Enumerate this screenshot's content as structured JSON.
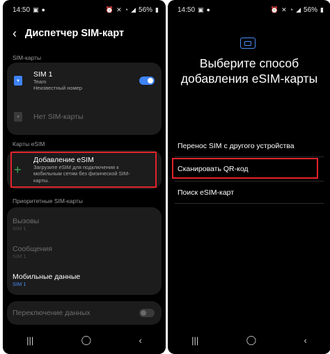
{
  "left": {
    "status": {
      "time": "14:50",
      "battery": "56%"
    },
    "title": "Диспетчер SIM-карт",
    "sim_section": "SIM-карты",
    "sim1": {
      "name": "SIM 1",
      "carrier": "Team",
      "number": "Неизвестный номер",
      "enabled": true
    },
    "sim2": {
      "name": "Нет SIM-карты"
    },
    "esim_section": "Карты eSIM",
    "add_esim": {
      "title": "Добавление eSIM",
      "desc": "Загрузите eSIM для подключения к мобильным сетям без физической SIM-карты."
    },
    "priority_section": "Приоритетные SIM-карты",
    "calls": {
      "title": "Вызовы",
      "value": "SIM 1"
    },
    "messages": {
      "title": "Сообщения",
      "value": "SIM 1"
    },
    "mobile_data": {
      "title": "Мобильные данные",
      "value": "SIM 1"
    },
    "data_switch": {
      "title": "Переключение данных",
      "enabled": false
    }
  },
  "right": {
    "status": {
      "time": "14:50",
      "battery": "56%"
    },
    "title": "Выберите способ добавления eSIM-карты",
    "options": [
      "Перенос SIM с другого устройства",
      "Сканировать QR-код",
      "Поиск eSIM-карт"
    ]
  },
  "colors": {
    "accent": "#3e83f6",
    "highlight": "#e2232a",
    "background": "#000000"
  },
  "icons": [
    "back-icon",
    "sim-card-icon",
    "plus-icon",
    "esim-icon",
    "recents-icon",
    "home-icon",
    "back-nav-icon"
  ]
}
